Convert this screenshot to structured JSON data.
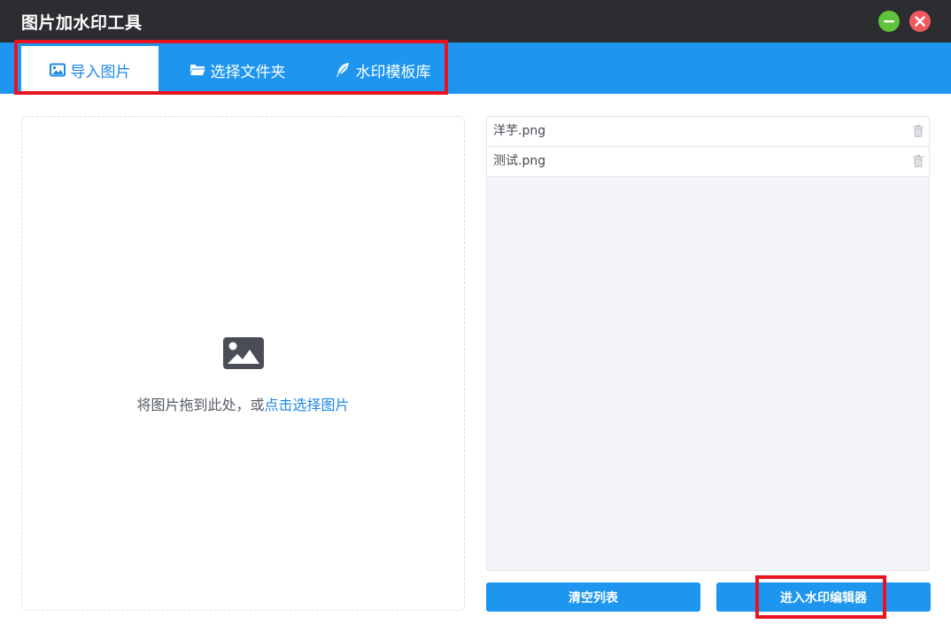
{
  "app": {
    "title": "图片加水印工具"
  },
  "window_controls": {
    "minimize_icon": "minimize-icon",
    "close_icon": "close-icon"
  },
  "tabs": [
    {
      "label": "导入图片",
      "icon": "image-icon",
      "active": true
    },
    {
      "label": "选择文件夹",
      "icon": "folder-open-icon",
      "active": false
    },
    {
      "label": "水印模板库",
      "icon": "feather-icon",
      "active": false
    }
  ],
  "dropzone": {
    "icon": "image-icon",
    "hint_text": "将图片拖到此处，或",
    "hint_link": "点击选择图片"
  },
  "files": [
    {
      "name": "洋芋.png"
    },
    {
      "name": "测试.png"
    }
  ],
  "buttons": {
    "clear_label": "清空列表",
    "enter_label": "进入水印编辑器"
  },
  "colors": {
    "accent": "#1e96f0",
    "titlebar": "#2b2d31",
    "highlight": "#e8131f",
    "link": "#1e88e5"
  }
}
